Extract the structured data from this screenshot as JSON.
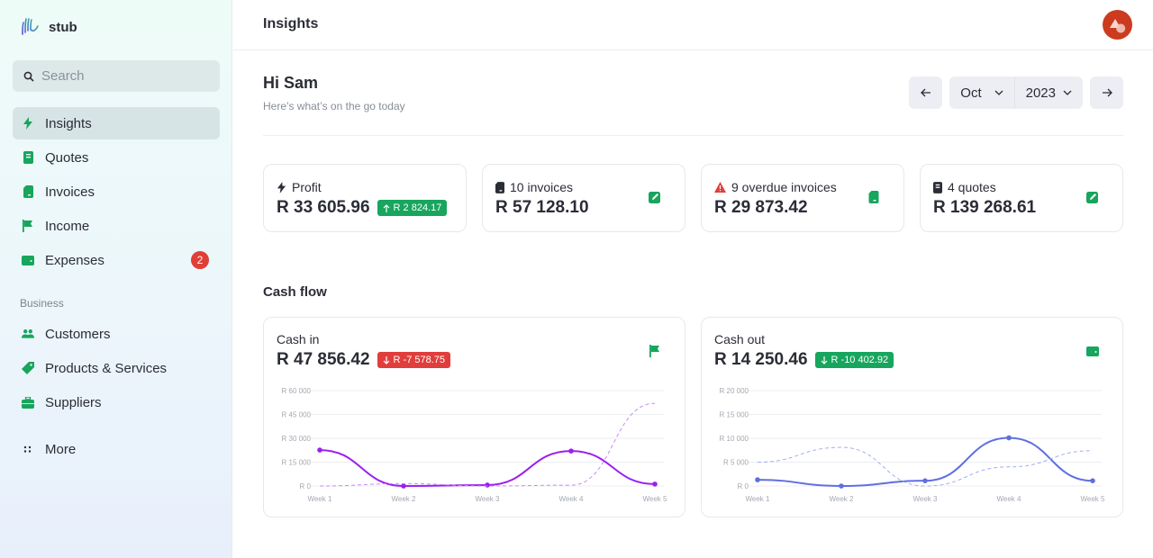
{
  "app": {
    "name": "stub"
  },
  "sidebar": {
    "search_placeholder": "Search",
    "items": [
      {
        "label": "Insights",
        "icon": "bolt-icon",
        "active": true
      },
      {
        "label": "Quotes",
        "icon": "document-icon"
      },
      {
        "label": "Invoices",
        "icon": "invoice-icon"
      },
      {
        "label": "Income",
        "icon": "flag-icon"
      },
      {
        "label": "Expenses",
        "icon": "wallet-icon",
        "badge": "2"
      }
    ],
    "section_label": "Business",
    "business_items": [
      {
        "label": "Customers",
        "icon": "users-icon"
      },
      {
        "label": "Products & Services",
        "icon": "tag-icon"
      },
      {
        "label": "Suppliers",
        "icon": "briefcase-icon"
      }
    ],
    "more_label": "More"
  },
  "header": {
    "title": "Insights"
  },
  "greeting": {
    "title": "Hi Sam",
    "subtitle": "Here’s what’s on the go today"
  },
  "date_nav": {
    "month": "Oct",
    "year": "2023",
    "prev_icon": "arrow-left-icon",
    "next_icon": "arrow-right-icon"
  },
  "stats": [
    {
      "label": "Profit",
      "icon": "bolt-icon",
      "value": "R 33 605.96",
      "delta": "R 2 824.17",
      "delta_dir": "up"
    },
    {
      "label": "10 invoices",
      "icon": "invoice-icon",
      "value": "R 57 128.10",
      "action": "edit-icon"
    },
    {
      "label": "9 overdue invoices",
      "icon": "warning-icon",
      "value": "R 29 873.42",
      "action": "invoice-icon"
    },
    {
      "label": "4 quotes",
      "icon": "document-icon",
      "value": "R 139 268.61",
      "action": "edit-icon"
    }
  ],
  "cash_flow": {
    "title": "Cash flow",
    "cash_in": {
      "label": "Cash in",
      "value": "R 47 856.42",
      "delta": "R -7 578.75",
      "delta_dir": "down",
      "icon": "flag-icon"
    },
    "cash_out": {
      "label": "Cash out",
      "value": "R 14 250.46",
      "delta": "R -10 402.92",
      "delta_dir": "down",
      "icon": "wallet-icon"
    }
  },
  "colors": {
    "accent": "#18a55d",
    "danger": "#e03e3c",
    "cash_in_line": "#9b1ff0",
    "cash_out_line": "#5e6fe0",
    "avatar": "#cc3b1f"
  },
  "chart_data": [
    {
      "type": "line",
      "title": "Cash in",
      "categories": [
        "Week 1",
        "Week 2",
        "Week 3",
        "Week 4",
        "Week 5"
      ],
      "yticks": [
        "R 0",
        "R 15 000",
        "R 30 000",
        "R 45 000",
        "R 60 000"
      ],
      "ylim": [
        0,
        60000
      ],
      "grid": true,
      "series": [
        {
          "name": "current",
          "style": "solid",
          "values": [
            22600,
            0,
            600,
            22000,
            1200
          ]
        },
        {
          "name": "previous",
          "style": "dashed",
          "values": [
            0,
            1500,
            0,
            500,
            52000
          ]
        }
      ]
    },
    {
      "type": "line",
      "title": "Cash out",
      "categories": [
        "Week 1",
        "Week 2",
        "Week 3",
        "Week 4",
        "Week 5"
      ],
      "yticks": [
        "R 0",
        "R 5 000",
        "R 10 000",
        "R 15 000",
        "R 20 000"
      ],
      "ylim": [
        0,
        20000
      ],
      "grid": true,
      "series": [
        {
          "name": "current",
          "style": "solid",
          "values": [
            1300,
            0,
            1100,
            10100,
            1100
          ]
        },
        {
          "name": "previous",
          "style": "dashed",
          "values": [
            5000,
            8100,
            0,
            4000,
            7400
          ]
        }
      ]
    }
  ]
}
